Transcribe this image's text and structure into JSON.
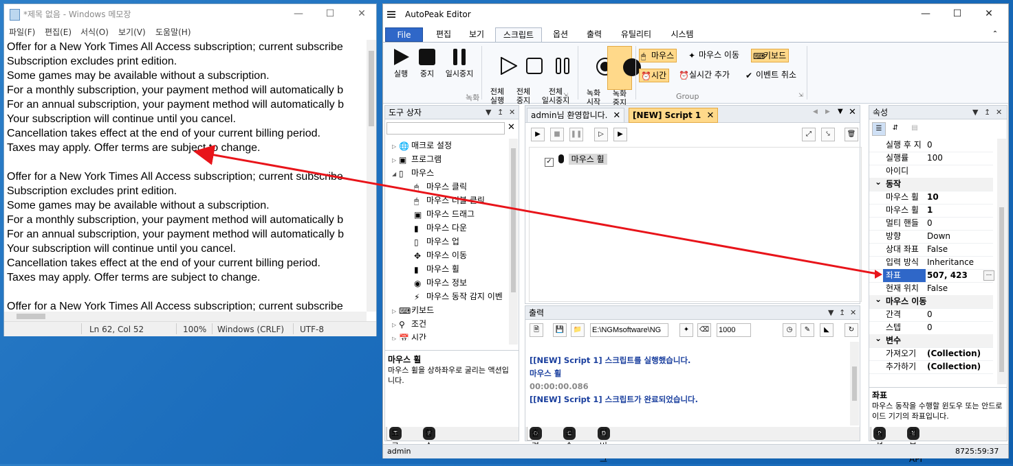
{
  "notepad": {
    "title": "*제목 없음 - Windows 메모장",
    "menu": [
      "파일(F)",
      "편집(E)",
      "서식(O)",
      "보기(V)",
      "도움말(H)"
    ],
    "lines": [
      "Offer for a New York Times All Access subscription; current subscribe",
      "Subscription excludes print edition.",
      "Some games may be available without a subscription.",
      "For a monthly subscription, your payment method will automatically b",
      "For an annual subscription, your payment method will automatically b",
      "Your subscription will continue until you cancel.",
      "Cancellation takes effect at the end of your current billing period.",
      "Taxes may apply. Offer terms are subject to change.",
      "",
      "Offer for a New York Times All Access subscription; current subscribe",
      "Subscription excludes print edition.",
      "Some games may be available without a subscription.",
      "For a monthly subscription, your payment method will automatically b",
      "For an annual subscription, your payment method will automatically b",
      "Your subscription will continue until you cancel.",
      "Cancellation takes effect at the end of your current billing period.",
      "Taxes may apply. Offer terms are subject to change.",
      "",
      "Offer for a New York Times All Access subscription; current subscribe"
    ],
    "status": {
      "position": "Ln 62, Col 52",
      "zoom": "100%",
      "eol": "Windows (CRLF)",
      "encoding": "UTF-8"
    }
  },
  "app": {
    "title": "AutoPeak Editor",
    "tabs": [
      "File",
      "편집",
      "보기",
      "스크립트",
      "옵션",
      "출력",
      "유틸리티",
      "시스템"
    ],
    "ribbon": {
      "run": "실행",
      "stop": "중지",
      "pause": "일시중지",
      "run_all": "전체\n실행",
      "stop_all": "전체\n중지",
      "pause_all": "전체\n일시중지",
      "rec_start": "녹화\n시작",
      "rec_stop": "녹화\n중지",
      "group_record": "녹화",
      "group_group": "Group",
      "mouse": "마우스",
      "mouse_move": "마우스 이동",
      "keyboard": "키보드",
      "time": "시간",
      "realtime_add": "실시간 추가",
      "event_cancel": "이벤트 취소"
    },
    "toolbox": {
      "title": "도구 상자",
      "items": [
        {
          "label": "매크로 설정"
        },
        {
          "label": "프로그램"
        },
        {
          "label": "마우스"
        },
        {
          "label": "마우스 클릭"
        },
        {
          "label": "마우스 더블 클릭"
        },
        {
          "label": "마우스 드래그"
        },
        {
          "label": "마우스 다운"
        },
        {
          "label": "마우스 업"
        },
        {
          "label": "마우스 이동"
        },
        {
          "label": "마우스 휠"
        },
        {
          "label": "마우스 정보"
        },
        {
          "label": "마우스 동작 감지 이벤"
        },
        {
          "label": "키보드"
        },
        {
          "label": "조건"
        },
        {
          "label": "시간"
        }
      ],
      "desc_title": "마우스 휠",
      "desc_text": "마우스 휠을 상하좌우로 굴리는 액션입니다.",
      "bottom_tabs": [
        "도구",
        "함수"
      ]
    },
    "doc": {
      "tabs": [
        "admin님 환영합니다.",
        "[NEW] Script 1"
      ],
      "node": "마우스 휠"
    },
    "output": {
      "title": "출력",
      "path": "E:\\NGMsoftware\\NG",
      "count": "1000",
      "lines": [
        "[[NEW] Script 1] 스크립트를 실행했습니다.",
        "마우스 휠",
        "00:00:00.086",
        "[[NEW] Script 1] 스크립트가 완료되었습니다."
      ],
      "bottom_tabs": [
        "출력",
        "콘솔",
        "디버그"
      ]
    },
    "props": {
      "title": "속성",
      "rows": [
        {
          "k": "실행 후 지",
          "v": "0"
        },
        {
          "k": "실행률",
          "v": "100"
        },
        {
          "k": "아이디",
          "v": ""
        },
        {
          "k": "동작",
          "v": "",
          "cat": true
        },
        {
          "k": "마우스 휠",
          "v": "10",
          "bold": true
        },
        {
          "k": "마우스 휠",
          "v": "1",
          "bold": true
        },
        {
          "k": "멀티 핸들",
          "v": "0"
        },
        {
          "k": "방향",
          "v": "Down"
        },
        {
          "k": "상대 좌표",
          "v": "False"
        },
        {
          "k": "입력 방식",
          "v": "Inheritance"
        },
        {
          "k": "좌표",
          "v": "507, 423",
          "bold": true,
          "sel": true
        },
        {
          "k": "현재 위치",
          "v": "False"
        },
        {
          "k": "마우스 이동",
          "v": "",
          "cat": true
        },
        {
          "k": "간격",
          "v": "0"
        },
        {
          "k": "스텝",
          "v": "0"
        },
        {
          "k": "변수",
          "v": "",
          "cat": true
        },
        {
          "k": "가져오기",
          "v": "(Collection)",
          "bold": true
        },
        {
          "k": "추가하기",
          "v": "(Collection)",
          "bold": true
        }
      ],
      "desc_title": "좌표",
      "desc_text": "마우스 동작을 수행할 윈도우 또는 안드로이드 기기의 좌표입니다.",
      "bottom_tabs": [
        "속성",
        "외부 API"
      ]
    },
    "status": {
      "user": "admin",
      "clock": "8725:59:37"
    }
  },
  "colors": {
    "accent": "#2f67c8",
    "arrow": "#e8141a",
    "highlight": "#ffd98a"
  }
}
